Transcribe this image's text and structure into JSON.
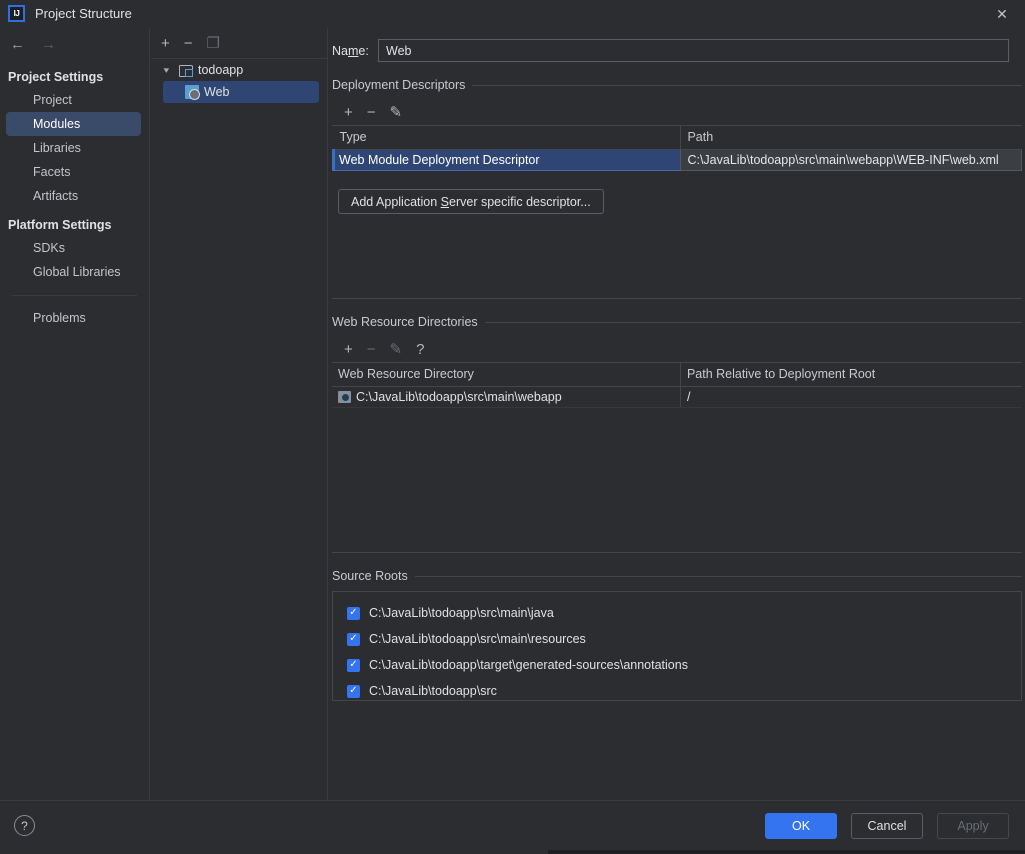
{
  "window": {
    "title": "Project Structure",
    "logo_icon": "intellij-idea-logo",
    "close_icon": "close-icon"
  },
  "nav": {
    "back_icon": "arrow-left-icon",
    "forward_icon": "arrow-right-icon",
    "groups": [
      {
        "title": "Project Settings",
        "items": [
          {
            "label": "Project",
            "selected": false
          },
          {
            "label": "Modules",
            "selected": true
          },
          {
            "label": "Libraries",
            "selected": false
          },
          {
            "label": "Facets",
            "selected": false
          },
          {
            "label": "Artifacts",
            "selected": false
          }
        ]
      },
      {
        "title": "Platform Settings",
        "items": [
          {
            "label": "SDKs",
            "selected": false
          },
          {
            "label": "Global Libraries",
            "selected": false
          }
        ]
      }
    ],
    "problems_label": "Problems"
  },
  "tree": {
    "toolbar": [
      {
        "name": "add-module-button",
        "glyph": "+",
        "enabled": true
      },
      {
        "name": "remove-module-button",
        "glyph": "−",
        "enabled": true
      },
      {
        "name": "copy-module-button",
        "glyph": "❐",
        "enabled": true
      }
    ],
    "root": {
      "label": "todoapp",
      "icon": "module-folder-icon",
      "expanded": true
    },
    "children": [
      {
        "label": "Web",
        "icon": "web-facet-icon",
        "selected": true
      }
    ]
  },
  "main": {
    "name_field": {
      "label_before": "Na",
      "label_mnemonic": "m",
      "label_after": "e:",
      "value": "Web",
      "placeholder": ""
    },
    "deployment_descriptors": {
      "title": "Deployment Descriptors",
      "toolbar": [
        {
          "name": "add-descriptor-button",
          "glyph": "+",
          "enabled": true
        },
        {
          "name": "remove-descriptor-button",
          "glyph": "−",
          "enabled": true
        },
        {
          "name": "edit-descriptor-button",
          "glyph": "✎",
          "enabled": true
        }
      ],
      "columns": [
        "Type",
        "Path"
      ],
      "rows": [
        {
          "type": "Web Module Deployment Descriptor",
          "path": "C:\\JavaLib\\todoapp\\src\\main\\webapp\\WEB-INF\\web.xml",
          "selected": true
        }
      ],
      "add_server_button": {
        "before": "Add Application ",
        "mnemonic": "S",
        "after": "erver specific descriptor..."
      }
    },
    "web_resource_directories": {
      "title": "Web Resource Directories",
      "toolbar": [
        {
          "name": "add-web-resource-button",
          "glyph": "+",
          "enabled": true
        },
        {
          "name": "remove-web-resource-button",
          "glyph": "−",
          "enabled": false
        },
        {
          "name": "edit-web-resource-button",
          "glyph": "✎",
          "enabled": false
        },
        {
          "name": "help-web-resource-button",
          "glyph": "?",
          "enabled": true
        }
      ],
      "columns": [
        "Web Resource Directory",
        "Path Relative to Deployment Root"
      ],
      "rows": [
        {
          "directory": "C:\\JavaLib\\todoapp\\src\\main\\webapp",
          "relative_path": "/",
          "icon": "directory-icon"
        }
      ]
    },
    "source_roots": {
      "title": "Source Roots",
      "items": [
        {
          "label": "C:\\JavaLib\\todoapp\\src\\main\\java",
          "checked": true
        },
        {
          "label": "C:\\JavaLib\\todoapp\\src\\main\\resources",
          "checked": true
        },
        {
          "label": "C:\\JavaLib\\todoapp\\target\\generated-sources\\annotations",
          "checked": true
        },
        {
          "label": "C:\\JavaLib\\todoapp\\src",
          "checked": true
        }
      ],
      "check_glyph": "✓"
    }
  },
  "footer": {
    "help_icon": "help-icon",
    "help_glyph": "?",
    "ok_label": "OK",
    "cancel_label": "Cancel",
    "apply_label": "Apply"
  },
  "colors": {
    "accent": "#3574f0",
    "selection": "#2f4675",
    "nav_selection": "#3a4a69",
    "background": "#2b2d30",
    "border": "#43454a"
  }
}
